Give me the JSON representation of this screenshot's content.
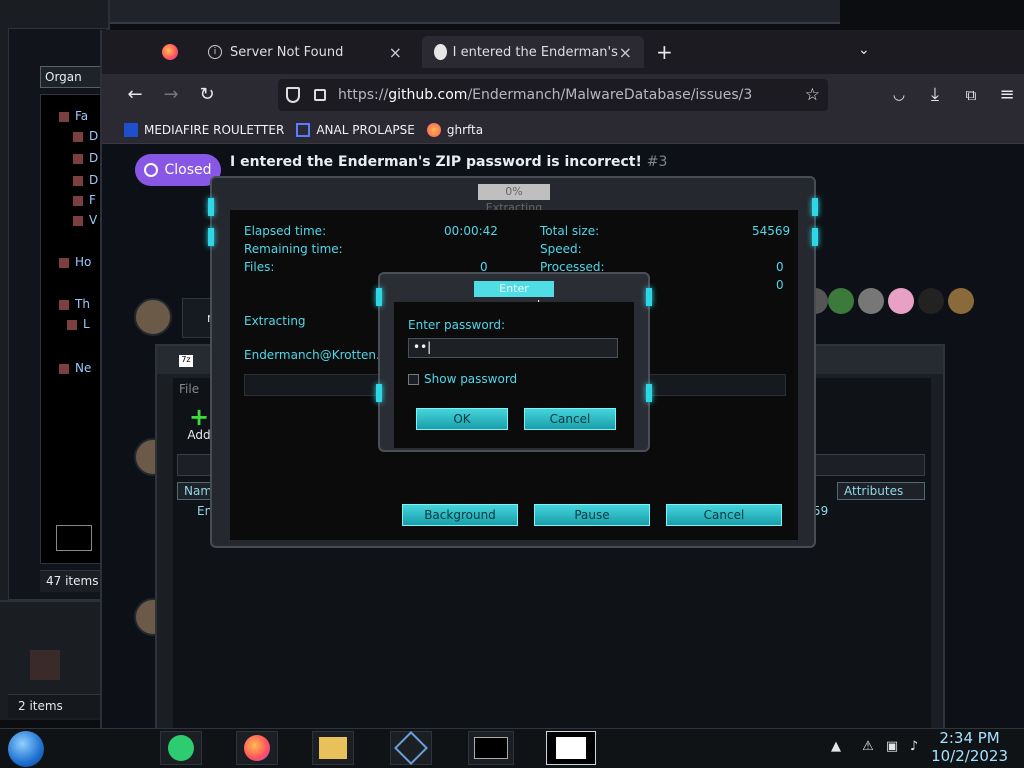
{
  "explorer": {
    "toolbar_label": "Organ",
    "tree_items": [
      "Fa",
      "D",
      "D",
      "D",
      "F",
      "V",
      "Ho",
      "Th",
      "L",
      "Ne"
    ],
    "status_items": "47 items"
  },
  "back_window": {
    "status_items": "2 items"
  },
  "firefox": {
    "tabs": [
      {
        "label": "Server Not Found"
      },
      {
        "label": "I entered the Enderman's ZIP pa"
      }
    ],
    "new_tab": "+",
    "url_prefix": "https://",
    "url_domain": "github.com",
    "url_path": "/Endermanch/MalwareDatabase/issues/3",
    "bookmarks": [
      {
        "label": "MEDIAFIRE ROULETTER",
        "icon": "mediafire-icon"
      },
      {
        "label": "ANAL PROLAPSE",
        "icon": "bookmark-icon"
      },
      {
        "label": "ghrfta",
        "icon": "firefox-icon"
      }
    ]
  },
  "issue": {
    "state": "Closed",
    "title": "I entered the Enderman's ZIP password is incorrect!",
    "number": "#3",
    "comment_snippet": "re"
  },
  "sevenzip_window": {
    "menu_file": "File",
    "add_label": "Add",
    "col_name": "Nam",
    "col_attributes": "Attributes",
    "row_name": "En",
    "row_size": "59"
  },
  "extract_dialog": {
    "title": "0% Extracting",
    "elapsed_label": "Elapsed time:",
    "elapsed_value": "00:00:42",
    "remaining_label": "Remaining time:",
    "files_label": "Files:",
    "files_value": "0",
    "total_size_label": "Total size:",
    "total_size_value": "54569",
    "speed_label": "Speed:",
    "processed_label": "Processed:",
    "processed_value": "0",
    "extra_value": "0",
    "status": "Extracting",
    "current_file": "Endermanch@Krotten.exe",
    "buttons": {
      "background": "Background",
      "pause": "Pause",
      "cancel": "Cancel"
    }
  },
  "password_dialog": {
    "title": "Enter password",
    "prompt": "Enter password:",
    "value": "••|",
    "show_password": "Show password",
    "ok": "OK",
    "cancel": "Cancel"
  },
  "taskbar": {
    "time": "2:34 PM",
    "date": "10/2/2023",
    "items": [
      "notes-icon",
      "firefox-icon",
      "file-explorer-icon",
      "virtualbox-icon",
      "cmd-icon",
      "sevenzip-icon"
    ]
  },
  "colors": {
    "accent_cyan": "#2fd6e6",
    "closed_purple": "#8957e5"
  }
}
